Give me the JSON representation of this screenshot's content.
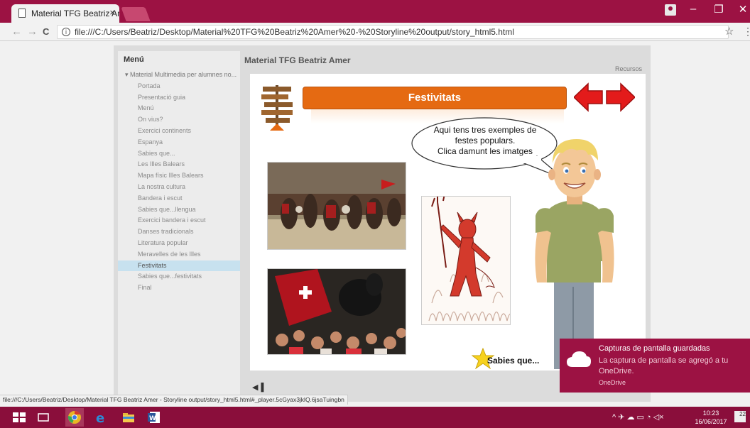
{
  "browser": {
    "tab_title": "Material TFG Beatriz Ame",
    "tab_close": "×",
    "url": "file:///C:/Users/Beatriz/Desktop/Material%20TFG%20Beatriz%20Amer%20-%20Storyline%20output/story_html5.html",
    "status_url": "file:///C:/Users/Beatriz/Desktop/Material TFG Beatriz Amer - Storyline output/story_html5.html#_player.5cGyax3jklQ.6jsaTuingbn",
    "window_buttons": {
      "minimize": "–",
      "restore": "❐",
      "close": "✕"
    },
    "nav": {
      "back": "←",
      "forward": "→",
      "reload": "C"
    }
  },
  "player": {
    "course_title": "Material TFG Beatriz Amer",
    "resources_label": "Recursos",
    "menu_title": "Menú",
    "menu_items": [
      {
        "label": "Material Multimedia per alumnes no...",
        "parent": true
      },
      {
        "label": "Portada"
      },
      {
        "label": "Presentació guia"
      },
      {
        "label": "Menú"
      },
      {
        "label": "On vius?"
      },
      {
        "label": "Exercici continents"
      },
      {
        "label": "Espanya"
      },
      {
        "label": "Sabies que..."
      },
      {
        "label": "Les Illes Balears"
      },
      {
        "label": "Mapa físic Illes Balears"
      },
      {
        "label": "La nostra cultura"
      },
      {
        "label": "Bandera i escut"
      },
      {
        "label": "Sabies que...llengua"
      },
      {
        "label": "Exercici bandera i escut"
      },
      {
        "label": "Danses tradicionals"
      },
      {
        "label": "Literatura popular"
      },
      {
        "label": "Meravelles de les Illes"
      },
      {
        "label": "Festivitats",
        "selected": true
      },
      {
        "label": "Sabies que...festivitats"
      },
      {
        "label": "Final"
      }
    ]
  },
  "slide": {
    "title": "Festivitats",
    "bubble_lines": [
      "Aqui tens tres exemples de",
      "festes populars.",
      "Clica damunt les imatges"
    ],
    "sabies_label": "Sabies que...",
    "banner_color": "#e56a12",
    "arrow_color": "#e31b1b"
  },
  "toast": {
    "title": "Capturas de pantalla guardadas",
    "body": "La captura de pantalla se agregó a tu OneDrive.",
    "source": "OneDrive"
  },
  "taskbar": {
    "time": "10:23",
    "date": "16/06/2017",
    "notifications": "22",
    "tray_icons": "^ ✈ ☁ ▭ ◔ ◁×"
  },
  "colors": {
    "accent": "#9c1243",
    "taskbar": "#8a0e3b"
  }
}
